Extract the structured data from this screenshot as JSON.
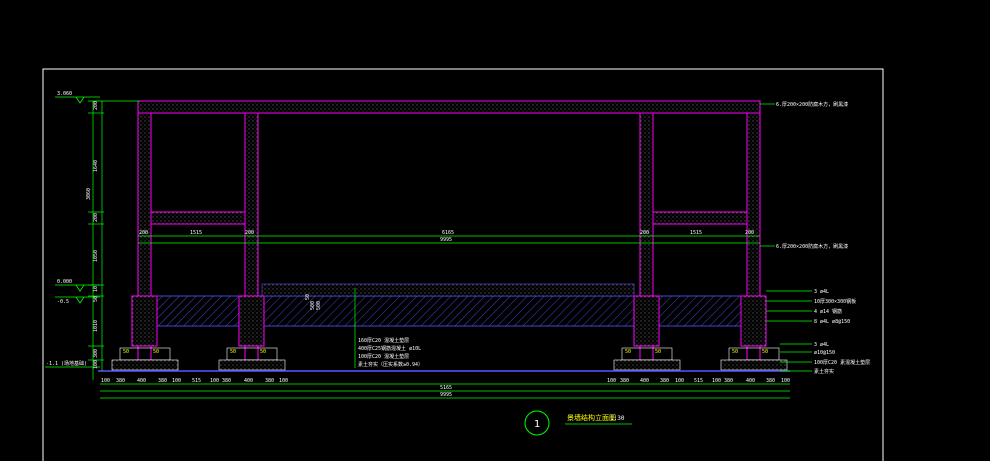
{
  "colors": {
    "background": "#000000",
    "frame": "#ffffff",
    "structure": "#ff00ff",
    "dimension": "#00ff00",
    "annotation": "#ffff00",
    "fill": "#6666ff",
    "text": "#ffffff"
  },
  "elevations": {
    "top": "3.060",
    "ground": "0.000",
    "minus": "-0.5",
    "bottom": "-1.1 (场地基础)"
  },
  "left_dims": [
    "200",
    "1640",
    "3060",
    "200",
    "1050",
    "10",
    "50",
    "1010",
    "300",
    "100"
  ],
  "inner_dims": {
    "bay_label": "1515",
    "col_label": "200",
    "mid_label": "6165",
    "total_label": "9995",
    "pit_label": "50",
    "pit_depth_1": "500",
    "pit_depth_2": "500"
  },
  "bottom_dims": {
    "row1": [
      "100",
      "380",
      "400",
      "380",
      "100",
      "515",
      "100",
      "380",
      "400",
      "380",
      "100",
      "5165",
      "100",
      "380",
      "400",
      "380",
      "100",
      "515",
      "100",
      "380",
      "400",
      "380",
      "100"
    ],
    "row2_center": "5165",
    "row3_total": "9995"
  },
  "right_notes": [
    "6.厚200×200防腐木方，刷黑漆",
    "6.厚200×200防腐木方，刷黑漆",
    "3 ø4L",
    "10厚300×300钢板",
    "4 ø14 钢筋",
    "8 ø4L ø8@150",
    "3 ø4L",
    "ø10@150",
    "100厚C20 素混凝土垫层",
    "素土夯实"
  ],
  "center_notes": [
    "160厚C20 混凝土垫层",
    "400厚C25钢筋混凝土 ø10L",
    "100厚C20 混凝土垫层",
    "素土夯实（压实系数≥0.94）"
  ],
  "title": {
    "number": "1",
    "name": "景墙结构立面图",
    "scale": "1:30"
  }
}
